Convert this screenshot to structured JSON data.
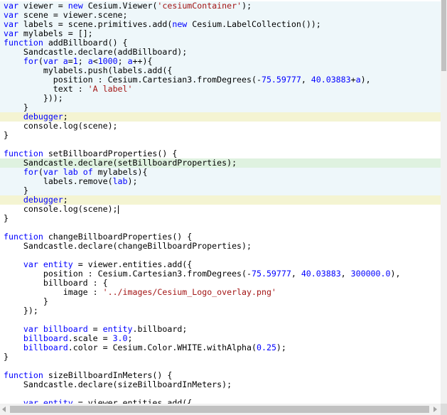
{
  "editor": {
    "lines": [
      [
        {
          "t": "var",
          "c": "kw"
        },
        {
          "t": " viewer = "
        },
        {
          "t": "new",
          "c": "kw"
        },
        {
          "t": " Cesium.Viewer("
        },
        {
          "t": "'cesiumContainer'",
          "c": "str"
        },
        {
          "t": ");"
        }
      ],
      [
        {
          "t": "var",
          "c": "kw"
        },
        {
          "t": " scene = viewer.scene;"
        }
      ],
      [
        {
          "t": "var",
          "c": "kw"
        },
        {
          "t": " labels = scene.primitives.add("
        },
        {
          "t": "new",
          "c": "kw"
        },
        {
          "t": " Cesium.LabelCollection());"
        }
      ],
      [
        {
          "t": "var",
          "c": "kw"
        },
        {
          "t": " mylabels = [];"
        }
      ],
      [
        {
          "t": "function",
          "c": "kw"
        },
        {
          "t": " addBillboard() {"
        }
      ],
      [
        {
          "t": "    Sandcastle.declare(addBillboard);"
        }
      ],
      [
        {
          "t": "    "
        },
        {
          "t": "for",
          "c": "kw"
        },
        {
          "t": "("
        },
        {
          "t": "var",
          "c": "kw"
        },
        {
          "t": " "
        },
        {
          "t": "a",
          "c": "def"
        },
        {
          "t": "="
        },
        {
          "t": "1",
          "c": "num"
        },
        {
          "t": "; "
        },
        {
          "t": "a",
          "c": "def"
        },
        {
          "t": "<"
        },
        {
          "t": "1000",
          "c": "num"
        },
        {
          "t": "; "
        },
        {
          "t": "a",
          "c": "def"
        },
        {
          "t": "++){"
        }
      ],
      [
        {
          "t": "        mylabels.push(labels.add({"
        }
      ],
      [
        {
          "t": "          position : Cesium.Cartesian3.fromDegrees(-"
        },
        {
          "t": "75.59777",
          "c": "num"
        },
        {
          "t": ", "
        },
        {
          "t": "40.03883",
          "c": "num"
        },
        {
          "t": "+"
        },
        {
          "t": "a",
          "c": "def"
        },
        {
          "t": "),"
        }
      ],
      [
        {
          "t": "          text : "
        },
        {
          "t": "'A label'",
          "c": "str"
        }
      ],
      [
        {
          "t": "        }));"
        }
      ],
      [
        {
          "t": "    }"
        }
      ],
      [
        {
          "t": "    "
        },
        {
          "t": "debugger",
          "c": "kw"
        },
        {
          "t": ";"
        }
      ],
      [
        {
          "t": "    console.log(scene);"
        }
      ],
      [
        {
          "t": "}"
        }
      ],
      [
        {
          "t": ""
        }
      ],
      [
        {
          "t": "function",
          "c": "kw"
        },
        {
          "t": " setBillboardProperties() {"
        }
      ],
      [
        {
          "t": "    Sandcastle.declare(setBillboardProperties);"
        }
      ],
      [
        {
          "t": "    "
        },
        {
          "t": "for",
          "c": "kw"
        },
        {
          "t": "("
        },
        {
          "t": "var",
          "c": "kw"
        },
        {
          "t": " "
        },
        {
          "t": "lab",
          "c": "def"
        },
        {
          "t": " "
        },
        {
          "t": "of",
          "c": "kw"
        },
        {
          "t": " mylabels){"
        }
      ],
      [
        {
          "t": "        labels.remove("
        },
        {
          "t": "lab",
          "c": "def"
        },
        {
          "t": ");"
        }
      ],
      [
        {
          "t": "    }"
        }
      ],
      [
        {
          "t": "    "
        },
        {
          "t": "debugger",
          "c": "kw"
        },
        {
          "t": ";"
        }
      ],
      [
        {
          "t": "    console.log(scene);"
        },
        {
          "t": "",
          "c": "cursor"
        }
      ],
      [
        {
          "t": "}"
        }
      ],
      [
        {
          "t": ""
        }
      ],
      [
        {
          "t": "function",
          "c": "kw"
        },
        {
          "t": " changeBillboardProperties() {"
        }
      ],
      [
        {
          "t": "    Sandcastle.declare(changeBillboardProperties);"
        }
      ],
      [
        {
          "t": ""
        }
      ],
      [
        {
          "t": "    "
        },
        {
          "t": "var",
          "c": "kw"
        },
        {
          "t": " "
        },
        {
          "t": "entity",
          "c": "def"
        },
        {
          "t": " = viewer.entities.add({"
        }
      ],
      [
        {
          "t": "        position : Cesium.Cartesian3.fromDegrees(-"
        },
        {
          "t": "75.59777",
          "c": "num"
        },
        {
          "t": ", "
        },
        {
          "t": "40.03883",
          "c": "num"
        },
        {
          "t": ", "
        },
        {
          "t": "300000.0",
          "c": "num"
        },
        {
          "t": "),"
        }
      ],
      [
        {
          "t": "        billboard : {"
        }
      ],
      [
        {
          "t": "            image : "
        },
        {
          "t": "'../images/Cesium_Logo_overlay.png'",
          "c": "str"
        }
      ],
      [
        {
          "t": "        }"
        }
      ],
      [
        {
          "t": "    });"
        }
      ],
      [
        {
          "t": ""
        }
      ],
      [
        {
          "t": "    "
        },
        {
          "t": "var",
          "c": "kw"
        },
        {
          "t": " "
        },
        {
          "t": "billboard",
          "c": "def"
        },
        {
          "t": " = "
        },
        {
          "t": "entity",
          "c": "def"
        },
        {
          "t": ".billboard;"
        }
      ],
      [
        {
          "t": "    "
        },
        {
          "t": "billboard",
          "c": "def"
        },
        {
          "t": ".scale = "
        },
        {
          "t": "3.0",
          "c": "num"
        },
        {
          "t": ";"
        }
      ],
      [
        {
          "t": "    "
        },
        {
          "t": "billboard",
          "c": "def"
        },
        {
          "t": ".color = Cesium.Color.WHITE.withAlpha("
        },
        {
          "t": "0.25",
          "c": "num"
        },
        {
          "t": ");"
        }
      ],
      [
        {
          "t": "}"
        }
      ],
      [
        {
          "t": ""
        }
      ],
      [
        {
          "t": "function",
          "c": "kw"
        },
        {
          "t": " sizeBillboardInMeters() {"
        }
      ],
      [
        {
          "t": "    Sandcastle.declare(sizeBillboardInMeters);"
        }
      ],
      [
        {
          "t": ""
        }
      ],
      [
        {
          "t": "    "
        },
        {
          "t": "var",
          "c": "kw"
        },
        {
          "t": " "
        },
        {
          "t": "entity",
          "c": "def"
        },
        {
          "t": " = viewer.entities.add({"
        }
      ]
    ],
    "highlights": {
      "blue": [
        0,
        1,
        2,
        3,
        4,
        5,
        6,
        7,
        8,
        9,
        10,
        11,
        18,
        19,
        20
      ],
      "yellow": [
        12,
        21
      ],
      "green": [
        17
      ]
    }
  },
  "colors": {
    "keyword": "#0000ff",
    "string": "#a31515",
    "highlight_blue": "#eef7fa",
    "highlight_yellow": "#f4f4d2",
    "highlight_green": "#dff2e0"
  },
  "scrollbars": {
    "vertical_position": 0.0,
    "horizontal_position": 0.0
  }
}
